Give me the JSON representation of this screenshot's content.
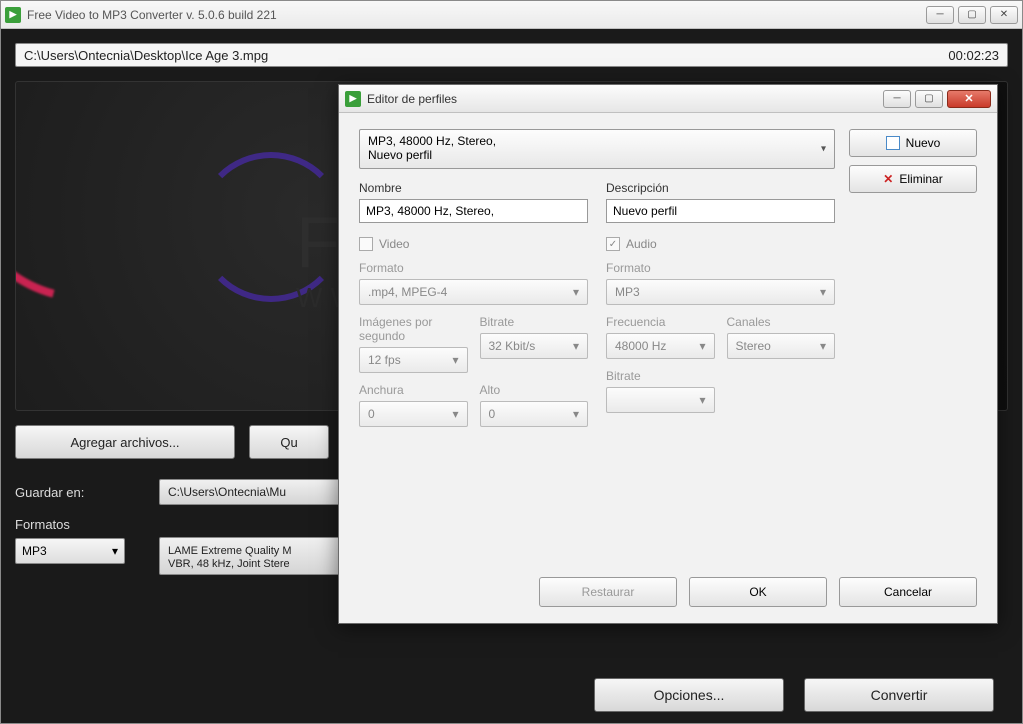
{
  "main": {
    "title": "Free Video to MP3 Converter  v. 5.0.6 build 221",
    "file_path": "C:\\Users\\Ontecnia\\Desktop\\Ice Age 3.mpg",
    "duration": "00:02:23",
    "preview_logo": "FR",
    "preview_sub": "WW",
    "add_files": "Agregar archivos...",
    "remove": "Qu",
    "save_in_label": "Guardar en:",
    "save_in_path": "C:\\Users\\Ontecnia\\Mu",
    "formats_label": "Formatos",
    "format_value": "MP3",
    "profile_line1": "LAME Extreme Quality M",
    "profile_line2": "VBR, 48 kHz, Joint Stere",
    "options_btn": "Opciones...",
    "convert_btn": "Convertir"
  },
  "dialog": {
    "title": "Editor de perfiles",
    "new_btn": "Nuevo",
    "delete_btn": "Eliminar",
    "combo_line1": "MP3, 48000 Hz, Stereo,",
    "combo_line2": "Nuevo perfil",
    "name_label": "Nombre",
    "name_value": "MP3, 48000 Hz, Stereo,",
    "desc_label": "Descripción",
    "desc_value": "Nuevo perfil",
    "video": {
      "title": "Video",
      "format_label": "Formato",
      "format_value": ".mp4, MPEG-4",
      "fps_label": "Imágenes por segundo",
      "fps_value": "12 fps",
      "bitrate_label": "Bitrate",
      "bitrate_value": "32 Kbit/s",
      "width_label": "Anchura",
      "width_value": "0",
      "height_label": "Alto",
      "height_value": "0"
    },
    "audio": {
      "title": "Audio",
      "format_label": "Formato",
      "format_value": "MP3",
      "freq_label": "Frecuencia",
      "freq_value": "48000 Hz",
      "channels_label": "Canales",
      "channels_value": "Stereo",
      "bitrate_label": "Bitrate",
      "bitrate_value": ""
    },
    "restore_btn": "Restaurar",
    "ok_btn": "OK",
    "cancel_btn": "Cancelar"
  }
}
